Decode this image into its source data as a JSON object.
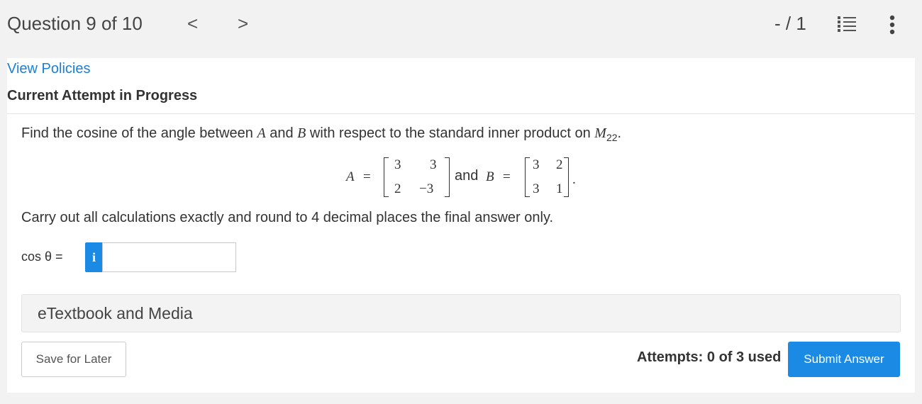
{
  "header": {
    "question_label": "Question 9 of 10",
    "prev_glyph": "<",
    "next_glyph": ">",
    "score": "- / 1",
    "list_icon": "numbered-list-icon",
    "more_icon": "vertical-ellipsis-icon"
  },
  "links": {
    "view_policies": "View Policies"
  },
  "status": {
    "current_attempt": "Current Attempt in Progress"
  },
  "question": {
    "prefix": "Find the cosine of the angle between ",
    "var_a": "A",
    "and_word": " and ",
    "var_b": "B",
    "middle": " with respect to the standard inner product on ",
    "space": "M",
    "space_sub": "22",
    "period": ".",
    "instruction": "Carry out all calculations exactly and round to 4 decimal places the final answer only."
  },
  "equation": {
    "a_label": "A",
    "equals": "=",
    "matrix_a": [
      [
        "3",
        "3"
      ],
      [
        "2",
        "−3"
      ]
    ],
    "joiner": "and",
    "b_label": "B",
    "matrix_b": [
      [
        "3",
        "2"
      ],
      [
        "3",
        "1"
      ]
    ],
    "end": "."
  },
  "answer": {
    "label": "cos θ =",
    "info_glyph": "i",
    "value": "",
    "placeholder": ""
  },
  "etextbook": {
    "label": "eTextbook and Media"
  },
  "footer": {
    "save_label": "Save for Later",
    "attempts": "Attempts: 0 of 3 used",
    "submit_label": "Submit Answer"
  },
  "colors": {
    "accent": "#1a8ae5",
    "link": "#1a7fd6",
    "background": "#f2f2f2"
  }
}
